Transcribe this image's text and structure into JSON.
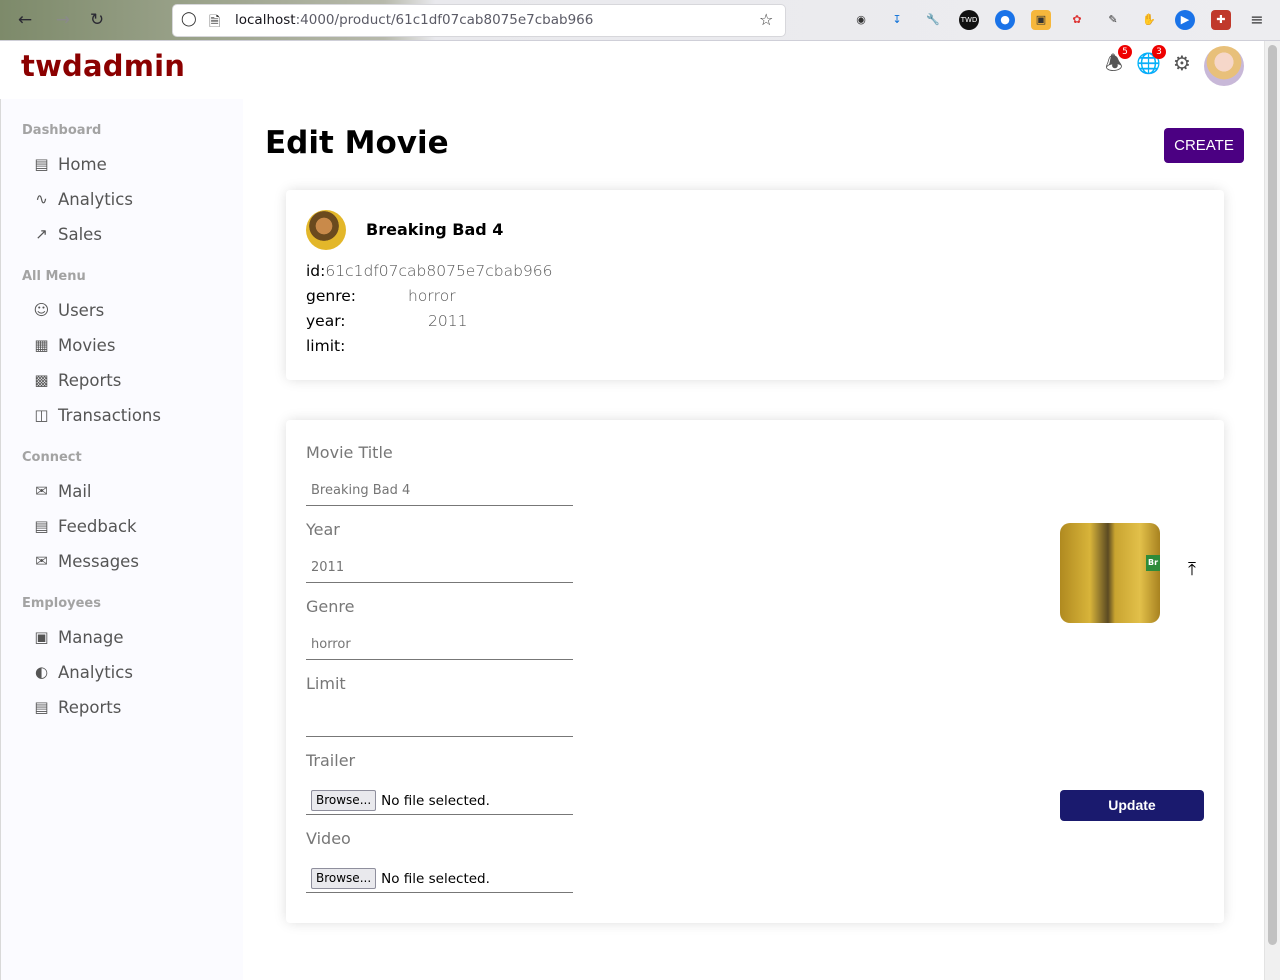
{
  "browser": {
    "url_host": "localhost",
    "url_rest": ":4000/product/61c1df07cab8075e7cbab966"
  },
  "topbar": {
    "logo": "twdadmin",
    "notifications_count": "5",
    "language_count": "3"
  },
  "sidebar": {
    "sections": [
      {
        "title": "Dashboard",
        "items": [
          {
            "label": "Home",
            "icon": "home-icon"
          },
          {
            "label": "Analytics",
            "icon": "timeline-icon"
          },
          {
            "label": "Sales",
            "icon": "trending-up-icon"
          }
        ]
      },
      {
        "title": "All Menu",
        "items": [
          {
            "label": "Users",
            "icon": "user-icon"
          },
          {
            "label": "Movies",
            "icon": "storefront-icon"
          },
          {
            "label": "Reports",
            "icon": "bar-chart-icon"
          },
          {
            "label": "Transactions",
            "icon": "money-icon"
          }
        ]
      },
      {
        "title": "Connect",
        "items": [
          {
            "label": "Mail",
            "icon": "mail-icon"
          },
          {
            "label": "Feedback",
            "icon": "feedback-icon"
          },
          {
            "label": "Messages",
            "icon": "chat-icon"
          }
        ]
      },
      {
        "title": "Employees",
        "items": [
          {
            "label": "Manage",
            "icon": "briefcase-icon"
          },
          {
            "label": "Analytics",
            "icon": "pie-chart-icon"
          },
          {
            "label": "Reports",
            "icon": "report-icon"
          }
        ]
      }
    ]
  },
  "main": {
    "title": "Edit Movie",
    "create_label": "CREATE",
    "info": {
      "name": "Breaking Bad 4",
      "id_label": "id:",
      "id_value": "61c1df07cab8075e7cbab966",
      "genre_label": "genre:",
      "genre_value": "horror",
      "year_label": "year:",
      "year_value": "2011",
      "limit_label": "limit:",
      "limit_value": ""
    },
    "form": {
      "title_label": "Movie Title",
      "title_placeholder": "Breaking Bad 4",
      "year_label": "Year",
      "year_placeholder": "2011",
      "genre_label": "Genre",
      "genre_placeholder": "horror",
      "limit_label": "Limit",
      "limit_placeholder": "",
      "trailer_label": "Trailer",
      "video_label": "Video",
      "browse_label": "Browse...",
      "no_file_text": "No file selected.",
      "update_label": "Update"
    }
  }
}
